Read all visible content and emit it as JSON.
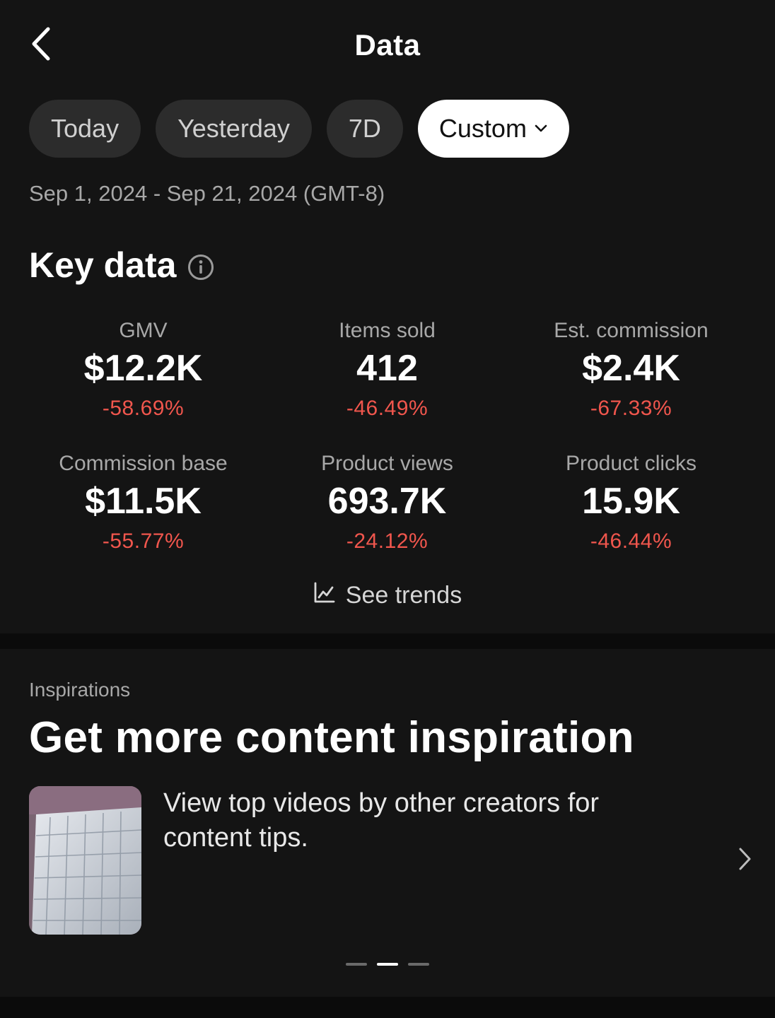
{
  "header": {
    "title": "Data",
    "back_icon": "chevron-left-icon"
  },
  "filters": {
    "today": "Today",
    "yesterday": "Yesterday",
    "seven_days": "7D",
    "custom": "Custom",
    "selected": "Custom"
  },
  "date_range": "Sep 1, 2024 - Sep 21, 2024 (GMT-8)",
  "key_data": {
    "title": "Key data",
    "metrics": [
      {
        "label": "GMV",
        "value": "$12.2K",
        "change": "-58.69%"
      },
      {
        "label": "Items sold",
        "value": "412",
        "change": "-46.49%"
      },
      {
        "label": "Est. commission",
        "value": "$2.4K",
        "change": "-67.33%"
      },
      {
        "label": "Commission base",
        "value": "$11.5K",
        "change": "-55.77%"
      },
      {
        "label": "Product views",
        "value": "693.7K",
        "change": "-24.12%"
      },
      {
        "label": "Product clicks",
        "value": "15.9K",
        "change": "-46.44%"
      }
    ],
    "see_trends": "See trends"
  },
  "inspirations": {
    "kicker": "Inspirations",
    "title": "Get more content inspiration",
    "description": "View top videos by other creators for content tips."
  },
  "colors": {
    "background": "#141414",
    "negative_change": "#f0564d",
    "active_chip": "#ffffff",
    "chip": "#2c2c2c"
  }
}
